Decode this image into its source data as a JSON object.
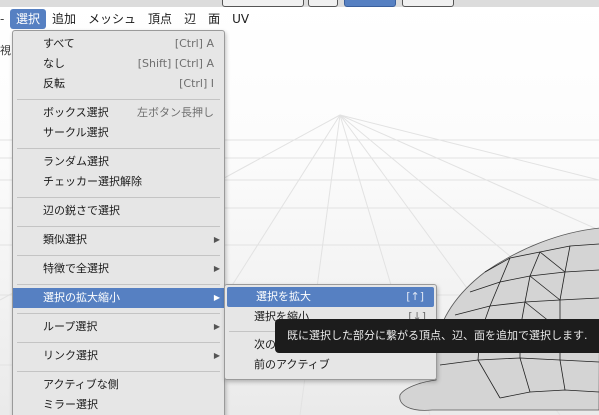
{
  "menubar": {
    "items": [
      {
        "label": "選択"
      },
      {
        "label": "追加"
      },
      {
        "label": "メッシュ"
      },
      {
        "label": "頂点"
      },
      {
        "label": "辺"
      },
      {
        "label": "面"
      },
      {
        "label": "UV"
      }
    ]
  },
  "viewport": {
    "partial_label": "視"
  },
  "select_menu": {
    "items": [
      {
        "label": "すべて",
        "shortcut": "[Ctrl] A"
      },
      {
        "label": "なし",
        "shortcut": "[Shift] [Ctrl] A"
      },
      {
        "label": "反転",
        "shortcut": "[Ctrl] I"
      },
      {
        "label": "ボックス選択",
        "shortcut": "左ボタン長押し"
      },
      {
        "label": "サークル選択"
      },
      {
        "label": "ランダム選択"
      },
      {
        "label": "チェッカー選択解除"
      },
      {
        "label": "辺の鋭さで選択"
      },
      {
        "label": "類似選択"
      },
      {
        "label": "特徴で全選択"
      },
      {
        "label": "選択の拡大縮小"
      },
      {
        "label": "ループ選択"
      },
      {
        "label": "リンク選択"
      },
      {
        "label": "アクティブな側"
      },
      {
        "label": "ミラー選択"
      }
    ]
  },
  "submenu": {
    "items": [
      {
        "label": "選択を拡大",
        "shortcut": "[↑]"
      },
      {
        "label": "選択を縮小",
        "shortcut": "[↓]"
      },
      {
        "label": "次のアクティブ"
      },
      {
        "label": "前のアクティブ"
      }
    ]
  },
  "tooltip": {
    "text": "既に選択した部分に繋がる頂点、辺、面を追加で選択します."
  },
  "colors": {
    "highlight": "#5680c2",
    "menu_bg": "#e6e6e6",
    "tooltip_bg": "#1c1c1c"
  }
}
